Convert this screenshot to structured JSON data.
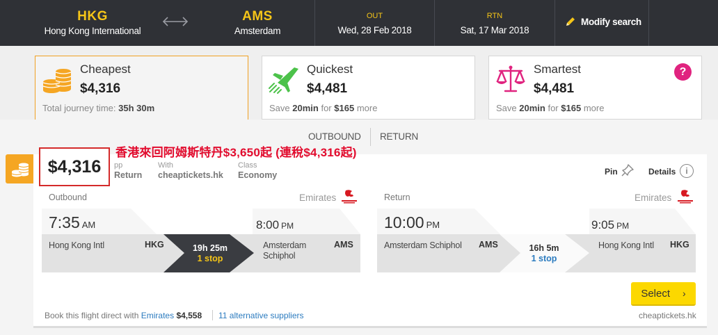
{
  "header": {
    "origin_code": "HKG",
    "origin_name": "Hong Kong International",
    "dest_code": "AMS",
    "dest_name": "Amsterdam",
    "out_label": "OUT",
    "out_date": "Wed, 28 Feb 2018",
    "rtn_label": "RTN",
    "rtn_date": "Sat, 17 Mar 2018",
    "modify_label": "Modify search"
  },
  "tabs": [
    {
      "name": "Cheapest",
      "price": "$4,316",
      "sub_prefix": "Total journey time:",
      "sub_value": "35h 30m"
    },
    {
      "name": "Quickest",
      "price": "$4,481",
      "sub_save": "Save",
      "sub_time": "20min",
      "sub_for": "for",
      "sub_amount": "$165",
      "sub_more": "more"
    },
    {
      "name": "Smartest",
      "price": "$4,481",
      "sub_save": "Save",
      "sub_time": "20min",
      "sub_for": "for",
      "sub_amount": "$165",
      "sub_more": "more",
      "help": "?"
    }
  ],
  "view_toggle": {
    "outbound": "OUTBOUND",
    "return": "RETURN"
  },
  "result": {
    "price": "$4,316",
    "pp": "pp",
    "return_label": "Return",
    "with_label": "With",
    "with_value": "cheaptickets.hk",
    "class_label": "Class",
    "class_value": "Economy",
    "pin_label": "Pin",
    "details_label": "Details",
    "info_icon": "i",
    "annotation": "香港來回阿姆斯特丹$3,650起 (連稅$4,316起)",
    "outbound": {
      "label": "Outbound",
      "airline": "Emirates",
      "dep_time": "7:35",
      "dep_ampm": "AM",
      "arr_time": "8:00",
      "arr_ampm": "PM",
      "dep_airport": "Hong Kong Intl",
      "dep_code": "HKG",
      "arr_airport": "Amsterdam Schiphol",
      "arr_code": "AMS",
      "duration": "19h 25m",
      "stops": "1 stop"
    },
    "inbound": {
      "label": "Return",
      "airline": "Emirates",
      "dep_time": "10:00",
      "dep_ampm": "PM",
      "arr_time": "9:05",
      "arr_ampm": "PM",
      "dep_airport": "Amsterdam Schiphol",
      "dep_code": "AMS",
      "arr_airport": "Hong Kong Intl",
      "arr_code": "HKG",
      "duration": "16h 5m",
      "stops": "1 stop"
    },
    "select_label": "Select",
    "footer": {
      "book_text": "Book this flight direct with",
      "airline": "Emirates",
      "airline_price": "$4,558",
      "alt_suppliers": "11 alternative suppliers",
      "supplier": "cheaptickets.hk"
    }
  },
  "colors": {
    "header_bg": "#2f3136",
    "accent_yellow": "#f5c518",
    "coin_orange": "#f5a623",
    "green": "#4cc24a",
    "magenta": "#e0237f",
    "dark_segment": "#3a3c41",
    "link_blue": "#2b7bbf",
    "highlight_red": "#d42a2a"
  },
  "icons": [
    "swap-arrows-icon",
    "pencil-icon",
    "coins-icon",
    "plane-takeoff-icon",
    "scales-icon",
    "help-icon",
    "pin-icon",
    "info-icon",
    "emirates-logo-icon",
    "chevron-right-icon"
  ]
}
